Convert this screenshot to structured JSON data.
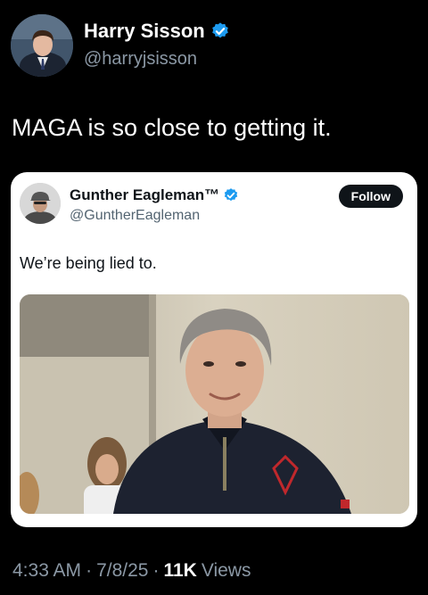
{
  "author": {
    "display_name": "Harry Sisson",
    "handle": "@harryjsisson",
    "verified": true,
    "avatar_icon": "profile-photo"
  },
  "tweet": {
    "text": "MAGA is so close to getting it."
  },
  "quoted": {
    "display_name": "Gunther Eagleman™",
    "handle": "@GuntherEagleman",
    "verified": true,
    "follow_label": "Follow",
    "text": "We’re being lied to.",
    "image_icon": "photo-man-dark-jacket"
  },
  "meta": {
    "time": "4:33 AM",
    "sep1": "·",
    "date": "7/8/25",
    "sep2": "·",
    "views_count": "11K",
    "views_label": "Views"
  },
  "colors": {
    "verified_blue": "#1d9bf0",
    "secondary_text": "#8b98a5"
  }
}
